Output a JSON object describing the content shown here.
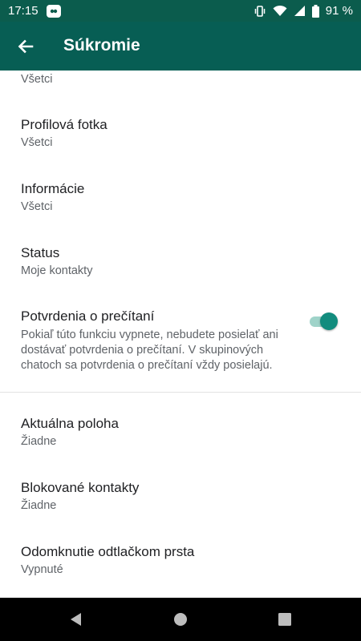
{
  "status_bar": {
    "time": "17:15",
    "battery": "91 %",
    "icons": [
      "app-notification-icon",
      "vibrate-icon",
      "wifi-icon",
      "signal-icon",
      "battery-icon"
    ]
  },
  "app_bar": {
    "title": "Súkromie",
    "back_icon": "arrow-back-icon"
  },
  "settings": {
    "partial_item_sub": "Všetci",
    "profile_photo": {
      "title": "Profilová fotka",
      "value": "Všetci"
    },
    "about": {
      "title": "Informácie",
      "value": "Všetci"
    },
    "status": {
      "title": "Status",
      "value": "Moje kontakty"
    },
    "read_receipts": {
      "title": "Potvrdenia o prečítaní",
      "description_line1": "Pokiaľ túto funkciu vypnete, nebudete posielať ani",
      "description_line2": "dostávať potvrdenia o prečítaní. V skupinových",
      "description_line3": "chatoch sa potvrdenia o prečítaní vždy posielajú.",
      "enabled": true
    },
    "live_location": {
      "title": "Aktuálna poloha",
      "value": "Žiadne"
    },
    "blocked_contacts": {
      "title": "Blokované kontakty",
      "value": "Žiadne"
    },
    "fingerprint_lock": {
      "title": "Odomknutie odtlačkom prsta",
      "value": "Vypnuté"
    }
  },
  "colors": {
    "status_bar": "#0b5c4d",
    "app_bar": "#075e54",
    "accent": "#128c7e",
    "toggle_track": "#9fd3c9"
  },
  "nav_bar": {
    "icons": [
      "back-triangle-icon",
      "home-circle-icon",
      "recents-square-icon"
    ]
  }
}
